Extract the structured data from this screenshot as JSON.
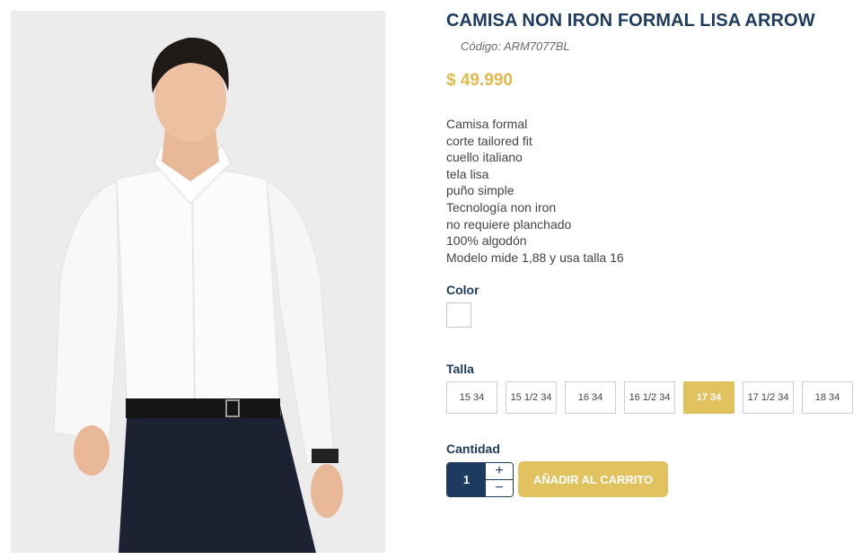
{
  "product": {
    "title": "CAMISA NON IRON FORMAL LISA ARROW",
    "code": "Código: ARM7077BL",
    "price": "$ 49.990",
    "description": [
      "Camisa formal",
      "corte tailored fit",
      "cuello italiano",
      "tela lisa",
      "puño simple",
      "Tecnología non iron",
      "no requiere planchado",
      "100% algodón",
      "Modelo mide 1,88 y usa talla 16"
    ]
  },
  "color": {
    "label": "Color",
    "swatches": [
      {
        "value": "#ffffff",
        "selected": true
      }
    ]
  },
  "size": {
    "label": "Talla",
    "options": [
      "15 34",
      "15 1/2 34",
      "16 34",
      "16 1/2 34",
      "17 34",
      "17 1/2 34",
      "18 34"
    ],
    "selected": "17 34"
  },
  "quantity": {
    "label": "Cantidad",
    "value": "1",
    "plus": "+",
    "minus": "−"
  },
  "cart": {
    "add_label": "AÑADIR AL CARRITO"
  },
  "icons": {
    "increment": "plus-icon",
    "decrement": "minus-icon"
  },
  "colors": {
    "brand_navy": "#1c3b5e",
    "accent_gold": "#e1c25e",
    "price_gold": "#e1b94a",
    "photo_bg": "#ececec"
  }
}
